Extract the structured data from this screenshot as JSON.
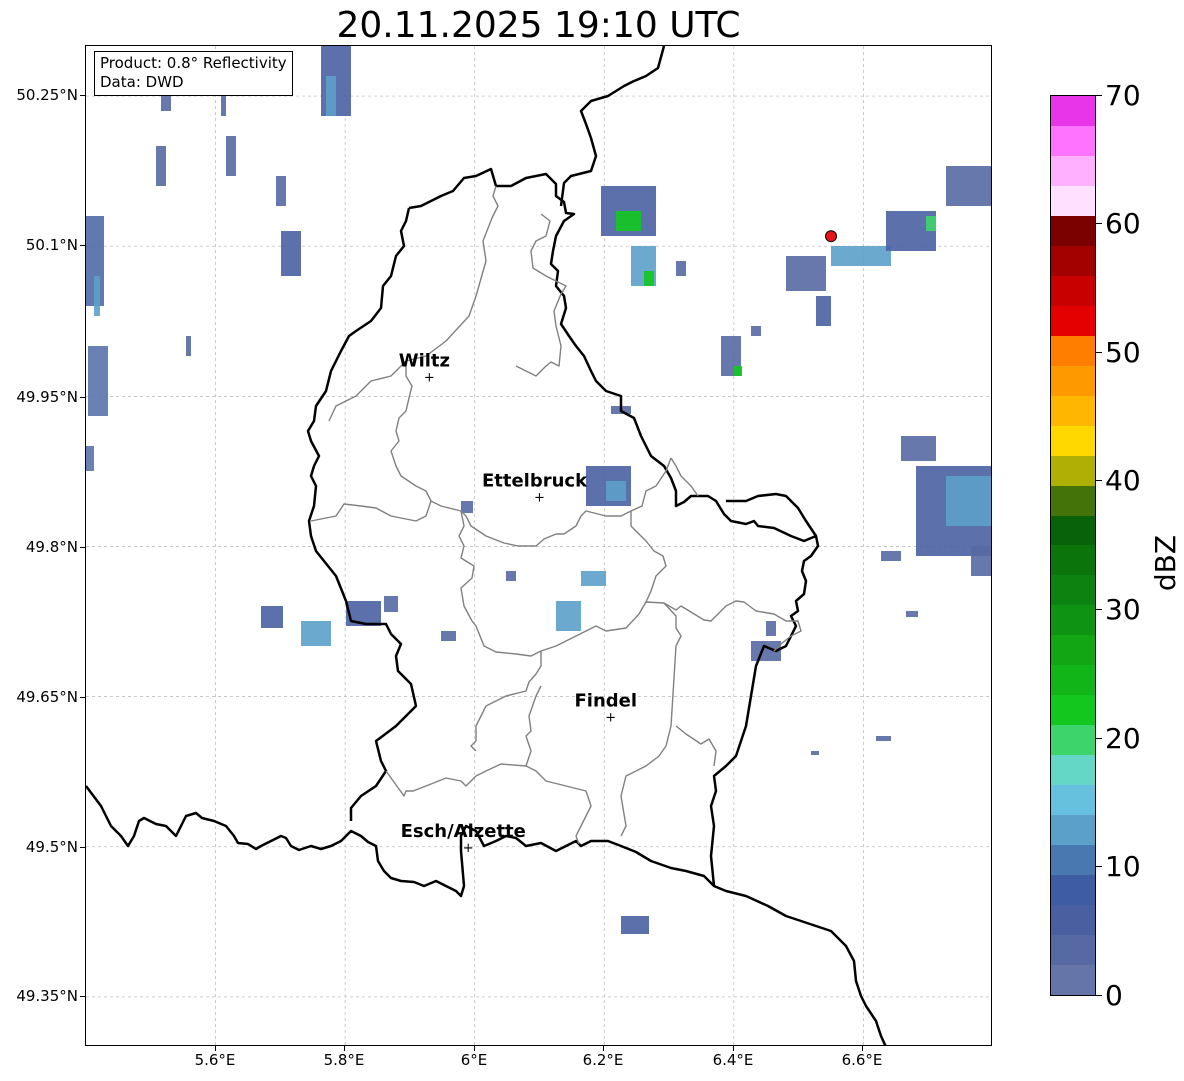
{
  "title": "20.11.2025 19:10 UTC",
  "info_box": {
    "product": "Product: 0.8° Reflectivity",
    "source": "Data: DWD"
  },
  "axes": {
    "y_ticks": [
      "50.25°N",
      "50.1°N",
      "49.95°N",
      "49.8°N",
      "49.65°N",
      "49.5°N",
      "49.35°N"
    ],
    "x_ticks": [
      "5.6°E",
      "5.8°E",
      "6°E",
      "6.2°E",
      "6.4°E",
      "6.6°E"
    ],
    "lon_range": [
      5.4,
      6.8
    ],
    "lat_range": [
      49.3,
      50.3
    ],
    "grid": true
  },
  "cities": [
    {
      "name": "Wiltz",
      "lon": 5.93,
      "lat": 49.97
    },
    {
      "name": "Ettelbruck",
      "lon": 6.1,
      "lat": 49.85
    },
    {
      "name": "Findel",
      "lon": 6.21,
      "lat": 49.63
    },
    {
      "name": "Esch/Alzette",
      "lon": 5.99,
      "lat": 49.5
    }
  ],
  "radar_site": {
    "lon": 6.55,
    "lat": 50.11,
    "color": "#e8141a"
  },
  "colorbar": {
    "label": "dBZ",
    "ticks": [
      "0",
      "10",
      "20",
      "30",
      "40",
      "50",
      "60",
      "70"
    ],
    "min": 0,
    "max": 70,
    "colors": [
      "#6575a8",
      "#5669a3",
      "#4a5fa0",
      "#3e5ca1",
      "#4978b1",
      "#5ba0c9",
      "#66c1de",
      "#65d7c6",
      "#3dd46b",
      "#12c81f",
      "#11b518",
      "#12a614",
      "#0e9412",
      "#0c8310",
      "#0b750c",
      "#07620a",
      "#437309",
      "#aeb103",
      "#ffd800",
      "#feb600",
      "#fe9a00",
      "#ff7e00",
      "#e40000",
      "#c80000",
      "#a30000",
      "#7b0000",
      "#ffe0ff",
      "#ffb1ff",
      "#ff73ff",
      "#e935e9"
    ]
  }
}
